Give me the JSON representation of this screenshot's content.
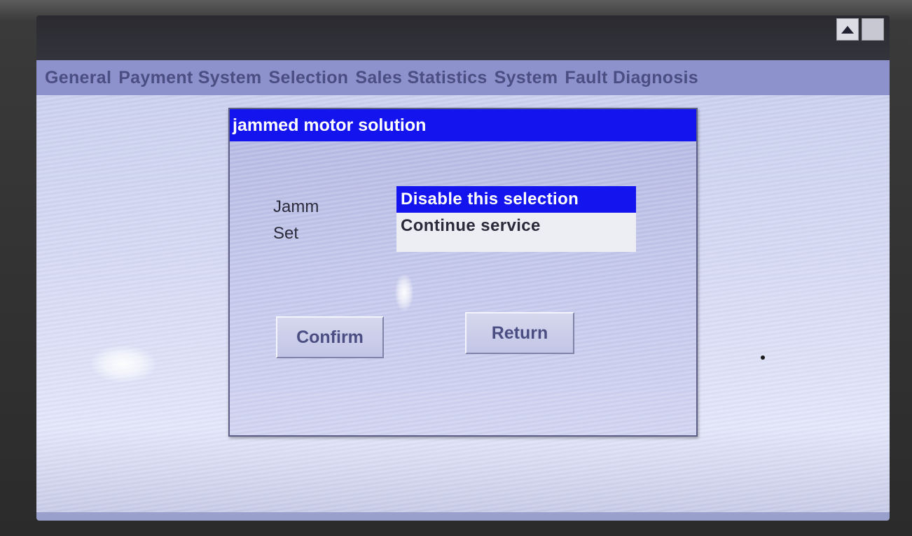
{
  "window": {
    "buttons": [
      {
        "icon": "up-arrow-icon"
      },
      {
        "icon": ""
      }
    ]
  },
  "menubar": {
    "items": [
      {
        "label": "General"
      },
      {
        "label": "Payment System"
      },
      {
        "label": "Selection"
      },
      {
        "label": "Sales Statistics"
      },
      {
        "label": "System"
      },
      {
        "label": "Fault Diagnosis"
      }
    ]
  },
  "dialog": {
    "title": "jammed motor solution",
    "label_line1": "Jamm",
    "label_line2": "Set",
    "options": [
      {
        "label": "Disable this selection",
        "selected": true
      },
      {
        "label": "Continue  service",
        "selected": false
      }
    ],
    "confirm_label": "Confirm",
    "return_label": "Return"
  },
  "colors": {
    "accent": "#1414ee",
    "menubar": "#8e92cc",
    "desktop": "#d6daf4"
  }
}
